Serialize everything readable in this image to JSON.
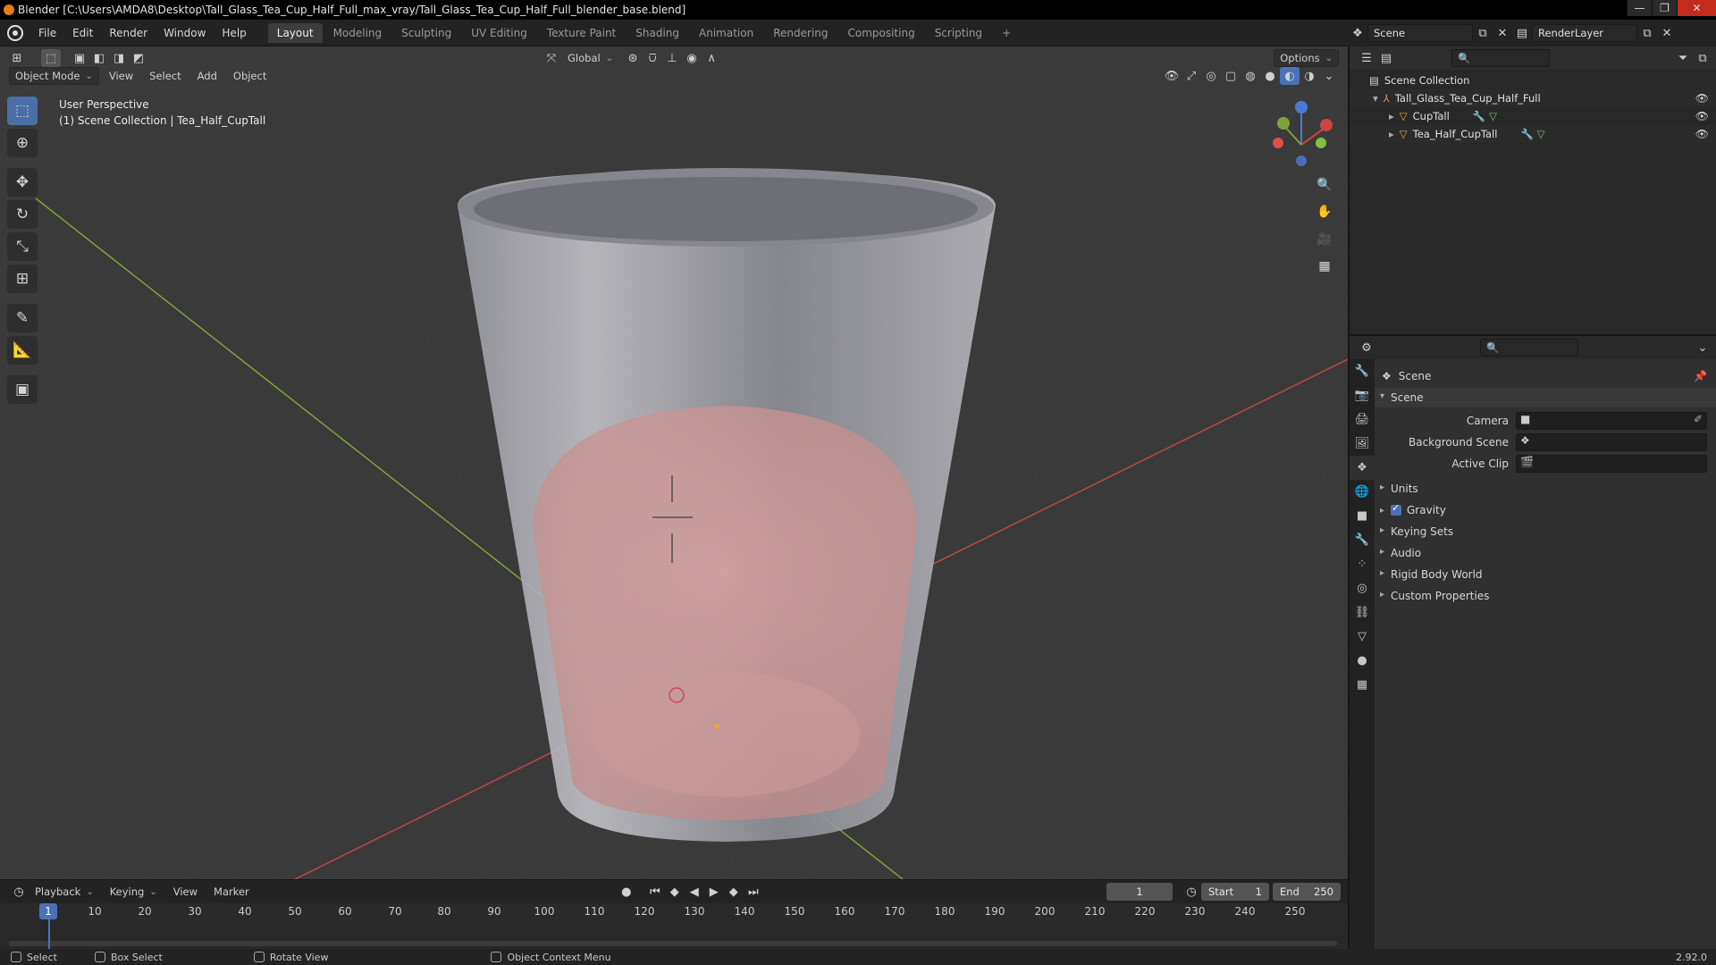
{
  "window": {
    "title": "Blender [C:\\Users\\AMDA8\\Desktop\\Tall_Glass_Tea_Cup_Half_Full_max_vray/Tall_Glass_Tea_Cup_Half_Full_blender_base.blend]",
    "minimize": "—",
    "maximize": "❐",
    "close": "✕"
  },
  "menubar": {
    "menus": [
      "File",
      "Edit",
      "Render",
      "Window",
      "Help"
    ],
    "workspaces": [
      "Layout",
      "Modeling",
      "Sculpting",
      "UV Editing",
      "Texture Paint",
      "Shading",
      "Animation",
      "Rendering",
      "Compositing",
      "Scripting"
    ],
    "active_workspace": "Layout",
    "add_workspace": "+"
  },
  "top_right": {
    "scene_name": "Scene",
    "view_layer": "RenderLayer"
  },
  "viewport": {
    "transform_orientation": "Global",
    "options_label": "Options",
    "mode": "Object Mode",
    "menus": [
      "View",
      "Select",
      "Add",
      "Object"
    ],
    "perspective_label": "User Perspective",
    "collection_label": "(1) Scene Collection | Tea_Half_CupTall",
    "gizmo_axes": {
      "x": "X",
      "y": "Y",
      "z": "Z"
    },
    "colors": {
      "background": "#393939",
      "x_axis": "#d04a4a",
      "y_axis": "#7fa33a",
      "glass": "#b8b8c0",
      "tea": "#d8a0a0"
    }
  },
  "outliner": {
    "root": "Scene Collection",
    "items": [
      {
        "label": "Tall_Glass_Tea_Cup_Half_Full",
        "level": 1
      },
      {
        "label": "CupTall",
        "level": 2
      },
      {
        "label": "Tea_Half_CupTall",
        "level": 2
      }
    ]
  },
  "properties": {
    "context_title": "Scene",
    "section_open": "Scene",
    "fields": [
      {
        "label": "Camera"
      },
      {
        "label": "Background Scene"
      },
      {
        "label": "Active Clip"
      }
    ],
    "sections": [
      "Units",
      "Gravity",
      "Keying Sets",
      "Audio",
      "Rigid Body World",
      "Custom Properties"
    ],
    "gravity_checked": true
  },
  "timeline": {
    "menus": [
      "Playback",
      "Keying",
      "View",
      "Marker"
    ],
    "current_frame": "1",
    "start_label": "Start",
    "start_value": "1",
    "end_label": "End",
    "end_value": "250",
    "ruler": [
      "10",
      "20",
      "30",
      "40",
      "50",
      "60",
      "70",
      "80",
      "90",
      "100",
      "110",
      "120",
      "130",
      "140",
      "150",
      "160",
      "170",
      "180",
      "190",
      "200",
      "210",
      "220",
      "230",
      "240",
      "250"
    ],
    "playhead_label": "1"
  },
  "statusbar": {
    "items": [
      "Select",
      "Box Select",
      "Rotate View",
      "Object Context Menu"
    ],
    "version": "2.92.0"
  }
}
